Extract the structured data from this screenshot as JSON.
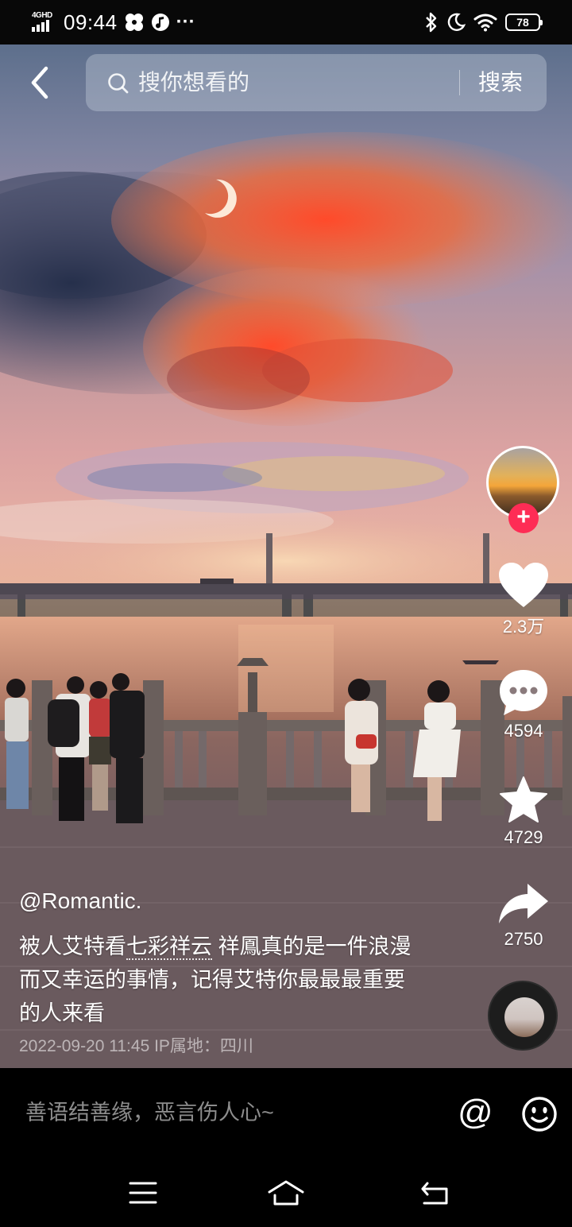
{
  "status_bar": {
    "network": "4GHD",
    "time": "09:44",
    "icons": [
      "pinwheel-icon",
      "music-note-icon",
      "more-dots-icon",
      "bluetooth-icon",
      "moon-icon",
      "wifi-icon"
    ],
    "dots": "···",
    "battery": "78"
  },
  "header": {
    "back_icon": "back-arrow-icon",
    "search_placeholder": "搜你想看的",
    "search_button": "搜索"
  },
  "actions": {
    "like_count": "2.3万",
    "comment_count": "4594",
    "favorite_count": "4729",
    "share_count": "2750",
    "follow_symbol": "+"
  },
  "video": {
    "author": "@Romantic.",
    "caption_prefix": "被人艾特看",
    "caption_tag": "七彩祥云",
    "caption_rest": " 祥鳳真的是一件浪漫而又幸运的事情，记得艾特你最最最重要的人来看",
    "meta": "2022-09-20 11:45  IP属地：四川"
  },
  "comment_bar": {
    "placeholder": "善语结善缘，恶言伤人心~",
    "at_symbol": "@",
    "emoji_icon": "smiley-icon"
  },
  "nav_bar": {
    "icons": [
      "menu-icon",
      "home-icon",
      "back-icon"
    ]
  },
  "colors": {
    "accent": "#fe2c55",
    "background": "#000000"
  }
}
